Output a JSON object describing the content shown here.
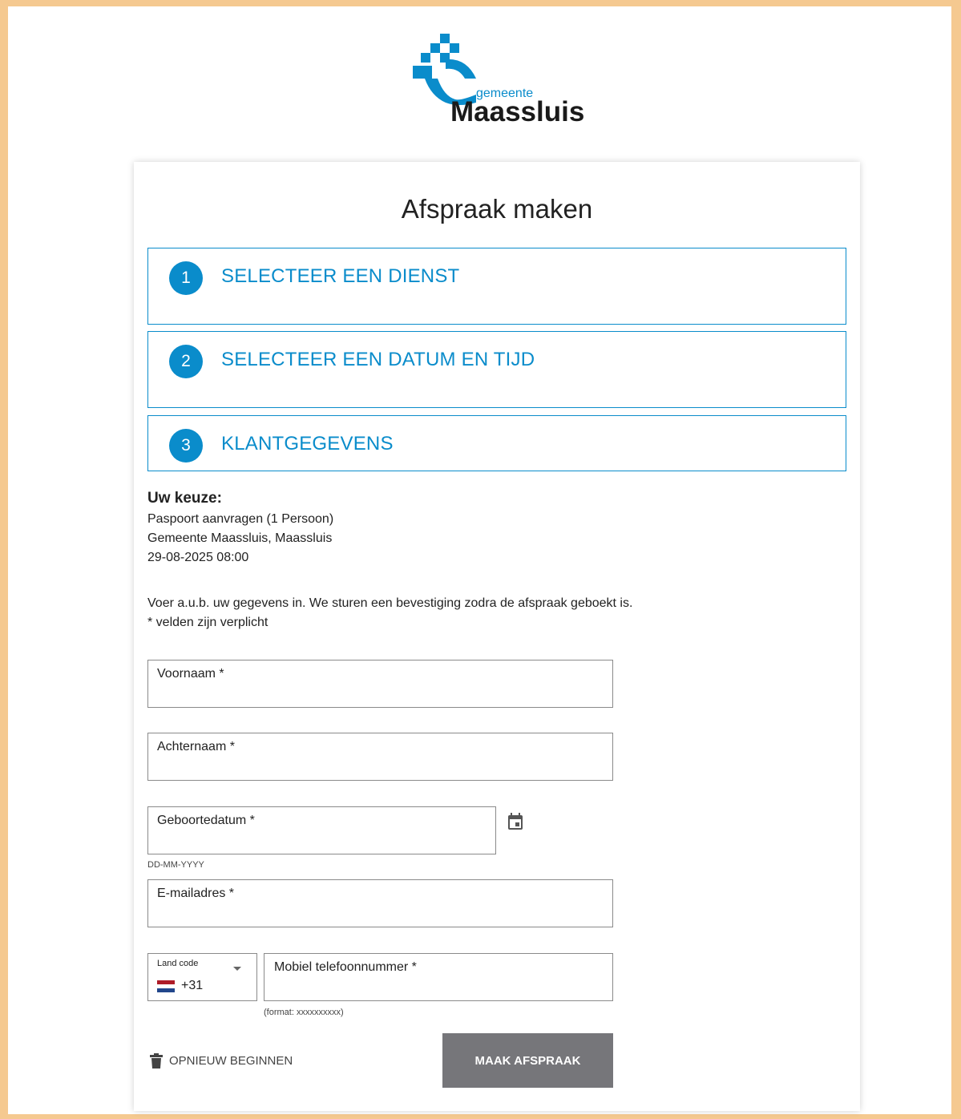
{
  "brand": {
    "small": "gemeente",
    "big": "Maassluis",
    "color": "#0a8ccb"
  },
  "page": {
    "title": "Afspraak maken"
  },
  "steps": [
    {
      "number": "1",
      "label": "SELECTEER EEN DIENST"
    },
    {
      "number": "2",
      "label": "SELECTEER EEN DATUM EN TIJD"
    },
    {
      "number": "3",
      "label": "KLANTGEGEVENS"
    }
  ],
  "summary": {
    "heading": "Uw keuze:",
    "service": "Paspoort aanvragen (1 Persoon)",
    "location": "Gemeente Maassluis, Maassluis",
    "datetime": "29-08-2025 08:00"
  },
  "intro": {
    "line1": "Voer a.u.b. uw gegevens in. We sturen een bevestiging zodra de afspraak geboekt is.",
    "line2": "* velden zijn verplicht"
  },
  "form": {
    "firstname": {
      "label": "Voornaam *",
      "value": ""
    },
    "lastname": {
      "label": "Achternaam *",
      "value": ""
    },
    "birthdate": {
      "label": "Geboortedatum *",
      "value": "",
      "hint": "DD-MM-YYYY",
      "icon": "calendar-icon"
    },
    "email": {
      "label": "E-mailadres *",
      "value": ""
    },
    "country": {
      "label": "Land code",
      "value": "+31",
      "flag": "netherlands-flag-icon"
    },
    "phone": {
      "label": "Mobiel telefoonnummer *",
      "value": "",
      "hint": "(format: xxxxxxxxxx)"
    }
  },
  "actions": {
    "restart": "OPNIEUW BEGINNEN",
    "restart_icon": "trash-icon",
    "submit": "MAAK AFSPRAAK"
  },
  "colors": {
    "accent": "#0a8ccb",
    "frame": "#f5c990",
    "submit_bg": "#76767a"
  }
}
